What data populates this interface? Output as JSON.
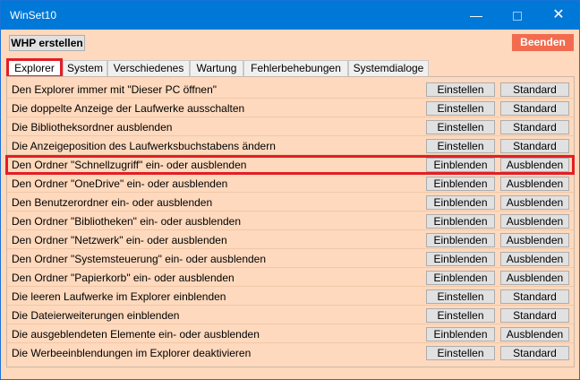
{
  "window": {
    "title": "WinSet10"
  },
  "toolbar": {
    "whp_label": "WHP erstellen",
    "exit_label": "Beenden"
  },
  "tabs": [
    {
      "label": "Explorer"
    },
    {
      "label": "System"
    },
    {
      "label": "Verschiedenes"
    },
    {
      "label": "Wartung"
    },
    {
      "label": "Fehlerbehebungen"
    },
    {
      "label": "Systemdialoge"
    }
  ],
  "rows": [
    {
      "label": "Den Explorer immer mit \"Dieser PC öffnen\"",
      "btn1": "Einstellen",
      "btn2": "Standard"
    },
    {
      "label": "Die doppelte Anzeige der Laufwerke ausschalten",
      "btn1": "Einstellen",
      "btn2": "Standard"
    },
    {
      "label": "Die Bibliotheksordner ausblenden",
      "btn1": "Einstellen",
      "btn2": "Standard"
    },
    {
      "label": "Die Anzeigeposition des Laufwerksbuchstabens ändern",
      "btn1": "Einstellen",
      "btn2": "Standard"
    },
    {
      "label": "Den Ordner \"Schnellzugriff\" ein- oder ausblenden",
      "btn1": "Einblenden",
      "btn2": "Ausblenden"
    },
    {
      "label": "Den Ordner \"OneDrive\" ein- oder ausblenden",
      "btn1": "Einblenden",
      "btn2": "Ausblenden"
    },
    {
      "label": "Den Benutzerordner ein- oder ausblenden",
      "btn1": "Einblenden",
      "btn2": "Ausblenden"
    },
    {
      "label": "Den Ordner \"Bibliotheken\" ein- oder ausblenden",
      "btn1": "Einblenden",
      "btn2": "Ausblenden"
    },
    {
      "label": "Den Ordner \"Netzwerk\" ein- oder ausblenden",
      "btn1": "Einblenden",
      "btn2": "Ausblenden"
    },
    {
      "label": "Den Ordner \"Systemsteuerung\" ein- oder ausblenden",
      "btn1": "Einblenden",
      "btn2": "Ausblenden"
    },
    {
      "label": "Den Ordner \"Papierkorb\" ein- oder ausblenden",
      "btn1": "Einblenden",
      "btn2": "Ausblenden"
    },
    {
      "label": "Die leeren Laufwerke im Explorer einblenden",
      "btn1": "Einstellen",
      "btn2": "Standard"
    },
    {
      "label": "Die Dateierweiterungen einblenden",
      "btn1": "Einstellen",
      "btn2": "Standard"
    },
    {
      "label": "Die ausgeblendeten Elemente ein- oder ausblenden",
      "btn1": "Einblenden",
      "btn2": "Ausblenden"
    },
    {
      "label": "Die Werbeeinblendungen im Explorer deaktivieren",
      "btn1": "Einstellen",
      "btn2": "Standard"
    }
  ]
}
